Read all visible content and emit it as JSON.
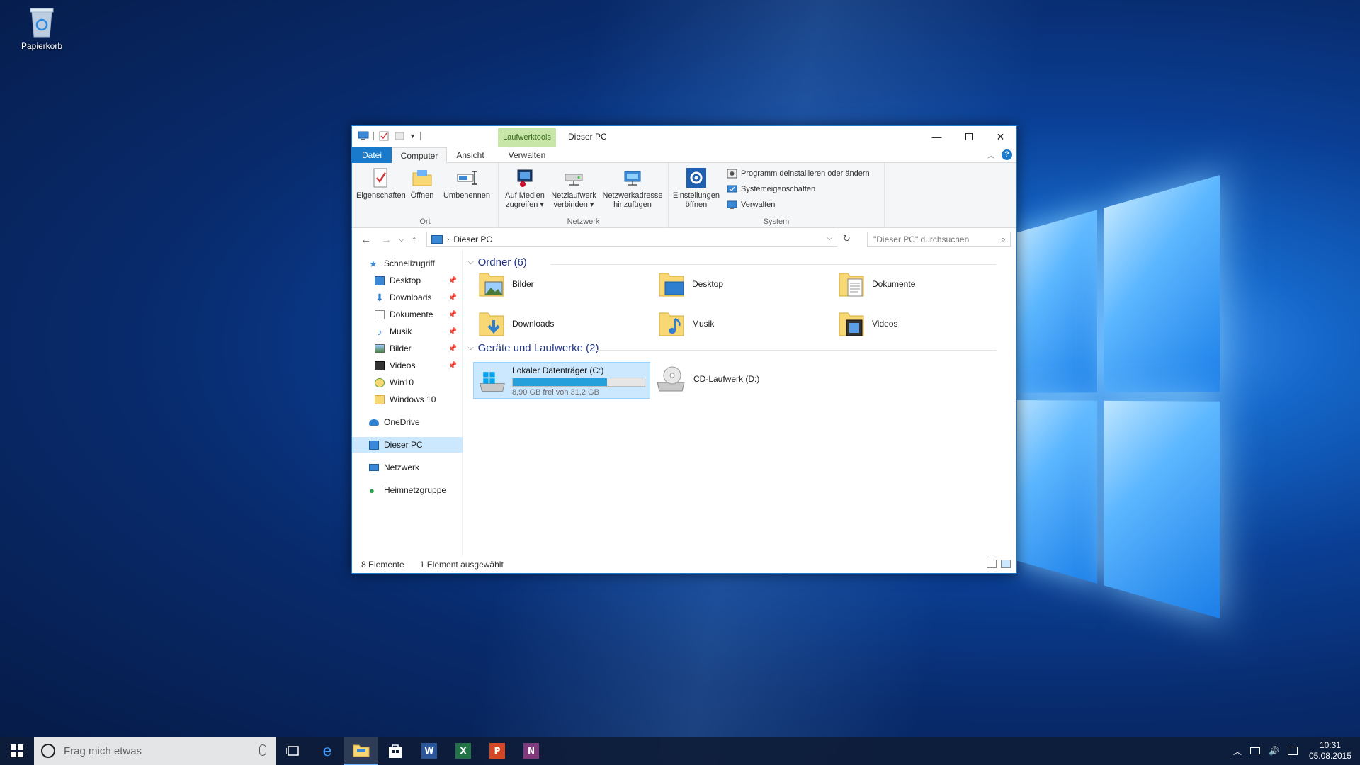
{
  "desktop": {
    "recycle_bin": "Papierkorb"
  },
  "window": {
    "title": "Dieser PC",
    "context_tab": "Laufwerktools",
    "tabs": [
      "Datei",
      "Computer",
      "Ansicht",
      "Verwalten"
    ],
    "ribbon": {
      "ort": {
        "label": "Ort",
        "buttons": [
          "Eigenschaften",
          "Öffnen",
          "Umbenennen"
        ]
      },
      "netzwerk": {
        "label": "Netzwerk",
        "buttons": [
          {
            "line1": "Auf Medien",
            "line2": "zugreifen ▾"
          },
          {
            "line1": "Netzlaufwerk",
            "line2": "verbinden ▾"
          },
          {
            "line1": "Netzwerkadresse",
            "line2": "hinzufügen"
          }
        ]
      },
      "system": {
        "label": "System",
        "big": {
          "line1": "Einstellungen",
          "line2": "öffnen"
        },
        "small": [
          "Programm deinstallieren oder ändern",
          "Systemeigenschaften",
          "Verwalten"
        ]
      }
    },
    "address": {
      "path": "Dieser PC",
      "search_placeholder": "\"Dieser PC\" durchsuchen"
    },
    "nav": {
      "quick_access": "Schnellzugriff",
      "pinned": [
        "Desktop",
        "Downloads",
        "Dokumente",
        "Musik",
        "Bilder",
        "Videos"
      ],
      "other": [
        "Win10",
        "Windows 10"
      ],
      "onedrive": "OneDrive",
      "this_pc": "Dieser PC",
      "network": "Netzwerk",
      "homegroup": "Heimnetzgruppe"
    },
    "folders_header": "Ordner (6)",
    "folders": [
      "Bilder",
      "Desktop",
      "Dokumente",
      "Downloads",
      "Musik",
      "Videos"
    ],
    "devices_header": "Geräte und Laufwerke (2)",
    "drive_c": {
      "name": "Lokaler Datenträger (C:)",
      "free_text": "8,90 GB frei von 31,2 GB",
      "used_fraction": 0.715
    },
    "drive_d": {
      "name": "CD-Laufwerk (D:)"
    },
    "status": {
      "items": "8 Elemente",
      "selected": "1 Element ausgewählt"
    }
  },
  "taskbar": {
    "search_placeholder": "Frag mich etwas",
    "apps": [
      "task-view",
      "edge",
      "file-explorer",
      "store",
      "word",
      "excel",
      "powerpoint",
      "onenote"
    ],
    "time": "10:31",
    "date": "05.08.2015"
  },
  "colors": {
    "accent": "#1979ca",
    "context_tab": "#c8e6a7",
    "selection": "#cce8ff",
    "drive_bar": "#26a0da"
  }
}
